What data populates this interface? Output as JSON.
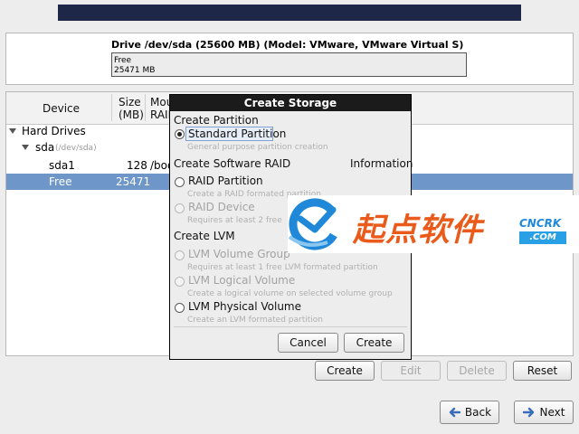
{
  "drive": {
    "title": "Drive /dev/sda (25600 MB) (Model: VMware, VMware Virtual S)",
    "bar_label": "Free",
    "bar_size": "25471 MB"
  },
  "tree": {
    "columns": {
      "device": "Device",
      "size": "Size",
      "size_unit": "(MB)",
      "mount": "Mou",
      "mount2": "RAID"
    },
    "rows": {
      "hard_drives": "Hard Drives",
      "sda": "sda",
      "sda_path": "(/dev/sda)",
      "sda1": "sda1",
      "sda1_size": "128",
      "sda1_mount": "/boo",
      "free": "Free",
      "free_size": "25471"
    }
  },
  "buttons": {
    "create": "Create",
    "edit": "Edit",
    "delete": "Delete",
    "reset": "Reset",
    "back": "Back",
    "next": "Next"
  },
  "dialog": {
    "title": "Create Storage",
    "section_partition": "Create Partition",
    "standard_partition": "Standard Partition",
    "standard_partition_desc": "General purpose partition creation",
    "section_raid": "Create Software RAID",
    "information": "Information",
    "raid_partition": "RAID Partition",
    "raid_partition_desc": "Create a RAID formated partition",
    "raid_device": "RAID Device",
    "raid_device_desc": "Requires at least 2 free",
    "section_lvm": "Create LVM",
    "lvm_volume_group": "LVM Volume Group",
    "lvm_volume_group_desc": "Requires at least 1 free LVM formated partition",
    "lvm_logical_volume": "LVM Logical Volume",
    "lvm_logical_volume_desc": "Create a logical volume on selected volume group",
    "lvm_physical_volume": "LVM Physical Volume",
    "lvm_physical_volume_desc": "Create an LVM formated partition",
    "cancel": "Cancel",
    "create": "Create",
    "selected_option": "Standard Partition"
  },
  "watermark": {
    "cn_text": "起点软件",
    "en_text": "CNCRK",
    "com_text": ".COM"
  },
  "colors": {
    "selection": "#6e96c8",
    "banner": "#1f2748",
    "dialog_titlebar": "#1b1b1b",
    "watermark_orange": "#ea5a1b",
    "watermark_blue": "#1f88d9"
  },
  "icons": {
    "tree_expander": "triangle-down",
    "back": "arrow-left",
    "next": "arrow-right"
  }
}
